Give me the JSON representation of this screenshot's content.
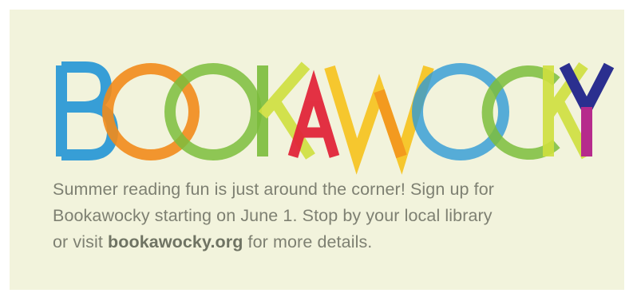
{
  "logo": {
    "text": "BOOKAWOCKY",
    "colors": {
      "blue": "#2e9ad6",
      "orange": "#f28b1b",
      "green": "#7cbd3c",
      "lime": "#cfe03e",
      "red": "#e2263a",
      "yellow": "#f6c21b",
      "navy": "#2b2f8f",
      "magenta": "#b62b8c"
    }
  },
  "message": {
    "line1": "Summer reading fun is just around the corner!  Sign up for",
    "line2": "Bookawocky starting on June 1. Stop by your local library",
    "line3_prefix": "or visit ",
    "link_text": "bookawocky.org",
    "line3_suffix": " for more details."
  }
}
